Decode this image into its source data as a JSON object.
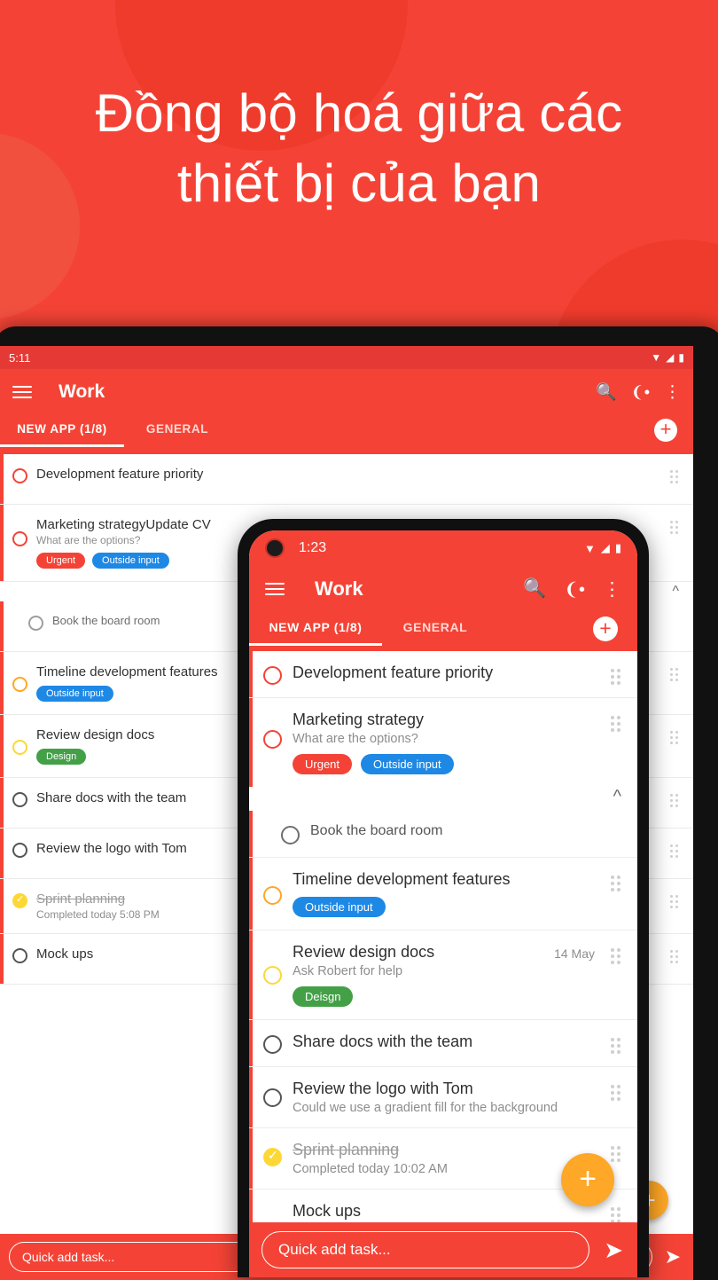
{
  "hero": {
    "line1": "Đồng bộ hoá giữa các",
    "line2": "thiết bị của bạn",
    "bg_color": "#F44336"
  },
  "tablet": {
    "status": {
      "time": "5:11",
      "icons": "wifi-signal-battery"
    },
    "appbar": {
      "menu_icon": "hamburger-icon",
      "title": "Work",
      "search_icon": "search-icon",
      "share_icon": "share-icon",
      "overflow_icon": "more-vert-icon"
    },
    "tabs": [
      {
        "label": "NEW APP (1/8)",
        "selected": true
      },
      {
        "label": "GENERAL",
        "selected": false
      }
    ],
    "add_button": "+",
    "tasks": [
      {
        "title": "Development feature priority",
        "sub": "",
        "chips": [],
        "state": "red"
      },
      {
        "title": "Marketing strategyUpdate CV",
        "sub": "What are the options?",
        "chips": [
          {
            "label": "Urgent",
            "color": "urgent"
          },
          {
            "label": "Outside input",
            "color": "outside"
          }
        ],
        "state": "red"
      },
      {
        "title": "Book the board room",
        "sub": "",
        "chips": [],
        "state": "grey",
        "sub_item": true
      },
      {
        "title": "Timeline development features",
        "sub": "",
        "chips": [
          {
            "label": "Outside input",
            "color": "outside"
          }
        ],
        "state": "orange"
      },
      {
        "title": "Review design docs",
        "sub": "",
        "chips": [
          {
            "label": "Design",
            "color": "design"
          }
        ],
        "state": "yellow"
      },
      {
        "title": "Share docs with the team",
        "sub": "",
        "chips": [],
        "state": "dark"
      },
      {
        "title": "Review the logo with Tom",
        "sub": "",
        "chips": [],
        "state": "dark"
      },
      {
        "title": "Sprint planning",
        "sub": "Completed today 5:08 PM",
        "chips": [],
        "state": "done"
      },
      {
        "title": "Mock ups",
        "sub": "",
        "chips": [],
        "state": "dark"
      }
    ],
    "quick_add": {
      "placeholder": "Quick add task...",
      "send_icon": "send-icon"
    },
    "fab": "+"
  },
  "phone": {
    "status": {
      "time": "1:23",
      "camera_icon": "front-camera-icon",
      "icons": "wifi-signal-battery"
    },
    "appbar": {
      "menu_icon": "hamburger-icon",
      "title": "Work",
      "search_icon": "search-icon",
      "share_icon": "share-icon",
      "overflow_icon": "more-vert-icon"
    },
    "tabs": [
      {
        "label": "NEW APP (1/8)",
        "selected": true
      },
      {
        "label": "GENERAL",
        "selected": false
      }
    ],
    "add_button": "+",
    "tasks": [
      {
        "title": "Development feature priority",
        "sub": "",
        "date": "",
        "chips": [],
        "state": "red"
      },
      {
        "title": "Marketing strategy",
        "sub": "What are the options?",
        "date": "",
        "chips": [
          {
            "label": "Urgent",
            "color": "urgent"
          },
          {
            "label": "Outside input",
            "color": "outside"
          }
        ],
        "state": "red"
      },
      {
        "title": "Book the board room",
        "sub": "",
        "date": "",
        "chips": [],
        "state": "grey"
      },
      {
        "title": "Timeline development features",
        "sub": "",
        "date": "",
        "chips": [
          {
            "label": "Outside input",
            "color": "outside"
          }
        ],
        "state": "orange"
      },
      {
        "title": "Review design docs",
        "sub": "Ask Robert for help",
        "date": "14 May",
        "chips": [
          {
            "label": "Deisgn",
            "color": "design"
          }
        ],
        "state": "yellow"
      },
      {
        "title": "Share docs with the team",
        "sub": "",
        "date": "",
        "chips": [],
        "state": "dark"
      },
      {
        "title": "Review the logo with Tom",
        "sub": "Could we use a gradient fill for the background",
        "date": "",
        "chips": [],
        "state": "dark"
      },
      {
        "title": "Sprint planning",
        "sub": "Completed today 10:02 AM",
        "date": "",
        "chips": [],
        "state": "done"
      },
      {
        "title": "Mock ups",
        "sub": "",
        "date": "",
        "chips": [],
        "state": "dark"
      }
    ],
    "quick_add": {
      "placeholder": "Quick add task...",
      "send_icon": "send-icon"
    },
    "fab": "+",
    "collapse_icon": "chevron-up-icon"
  },
  "colors": {
    "primary": "#F44336",
    "accent": "#FFA726",
    "chip_urgent": "#F44336",
    "chip_outside": "#1E88E5",
    "chip_design": "#43A047"
  }
}
